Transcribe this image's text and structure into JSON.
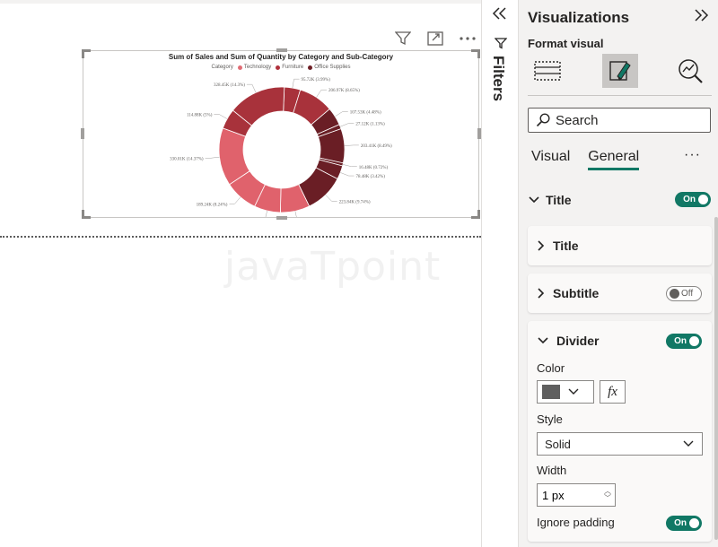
{
  "visual_header": {
    "filter_icon": "funnel-icon",
    "focus_icon": "focus-mode-icon",
    "more_icon": "more-options-icon"
  },
  "chart_data": {
    "type": "pie",
    "subtype": "donut",
    "title": "Sum of Sales and Sum of Quantity by Category and Sub-Category",
    "legend_title": "Category",
    "legend": [
      {
        "name": "Technology",
        "color": "#e06c75"
      },
      {
        "name": "Furniture",
        "color": "#b0323c"
      },
      {
        "name": "Office Supplies",
        "color": "#6e1f26"
      }
    ],
    "legend_placement": "top",
    "slices": [
      {
        "label": "95.72K (3.99%)",
        "value": 3.99,
        "category": "Furniture",
        "color": "#a8323b"
      },
      {
        "label": "206.97K (8.65%)",
        "value": 8.65,
        "category": "Furniture",
        "color": "#a8323b"
      },
      {
        "label": "107.53K (4.48%)",
        "value": 4.48,
        "category": "Office Supplies",
        "color": "#6a1e25"
      },
      {
        "label": "27.12K (1.13%)",
        "value": 1.13,
        "category": "Office Supplies",
        "color": "#6a1e25"
      },
      {
        "label": "203.41K (8.49%)",
        "value": 8.49,
        "category": "Office Supplies",
        "color": "#6a1e25"
      },
      {
        "label": "16.48K (0.72%)",
        "value": 0.72,
        "category": "Office Supplies",
        "color": "#6a1e25"
      },
      {
        "label": "78.48K (3.42%)",
        "value": 3.42,
        "category": "Office Supplies",
        "color": "#6a1e25"
      },
      {
        "label": "223.84K (9.74%)",
        "value": 9.74,
        "category": "Office Supplies",
        "color": "#6a1e25"
      },
      {
        "label": "167.38K (7.29%)",
        "value": 7.29,
        "category": "Technology",
        "color": "#e0626c"
      },
      {
        "label": "149.53K (6.51%)",
        "value": 6.51,
        "category": "Technology",
        "color": "#e0626c"
      },
      {
        "label": "189.24K (8.24%)",
        "value": 8.24,
        "category": "Technology",
        "color": "#e0626c"
      },
      {
        "label": "330.01K (14.37%)",
        "value": 14.37,
        "category": "Technology",
        "color": "#e0626c"
      },
      {
        "label": "114.88K (5%)",
        "value": 5.0,
        "category": "Furniture",
        "color": "#a8323b"
      },
      {
        "label": "328.45K (14.3%)",
        "value": 14.3,
        "category": "Furniture",
        "color": "#a8323b"
      }
    ]
  },
  "watermark": "javaTpoint",
  "filters": {
    "label": "Filters",
    "collapse_icon": "double-chevron-left-icon",
    "funnel_icon": "funnel-icon"
  },
  "viz_pane": {
    "title": "Visualizations",
    "expand_icon": "double-chevron-right-icon",
    "subtitle": "Format visual",
    "icons": [
      "build-visual-icon",
      "format-visual-icon",
      "analytics-icon"
    ],
    "search_placeholder": "Search",
    "tabs": [
      {
        "label": "Visual",
        "active": false
      },
      {
        "label": "General",
        "active": true
      }
    ],
    "more_label": "···",
    "title_section": {
      "label": "Title",
      "toggle": "On"
    },
    "cards": {
      "title": {
        "label": "Title"
      },
      "subtitle": {
        "label": "Subtitle",
        "toggle": "Off"
      },
      "divider": {
        "label": "Divider",
        "toggle": "On",
        "color_label": "Color",
        "color_value": "#5f5f5f",
        "fx_label": "fx",
        "style_label": "Style",
        "style_value": "Solid",
        "width_label": "Width",
        "width_value": "1 px",
        "ignore_padding_label": "Ignore padding",
        "ignore_padding_toggle": "On"
      }
    }
  }
}
